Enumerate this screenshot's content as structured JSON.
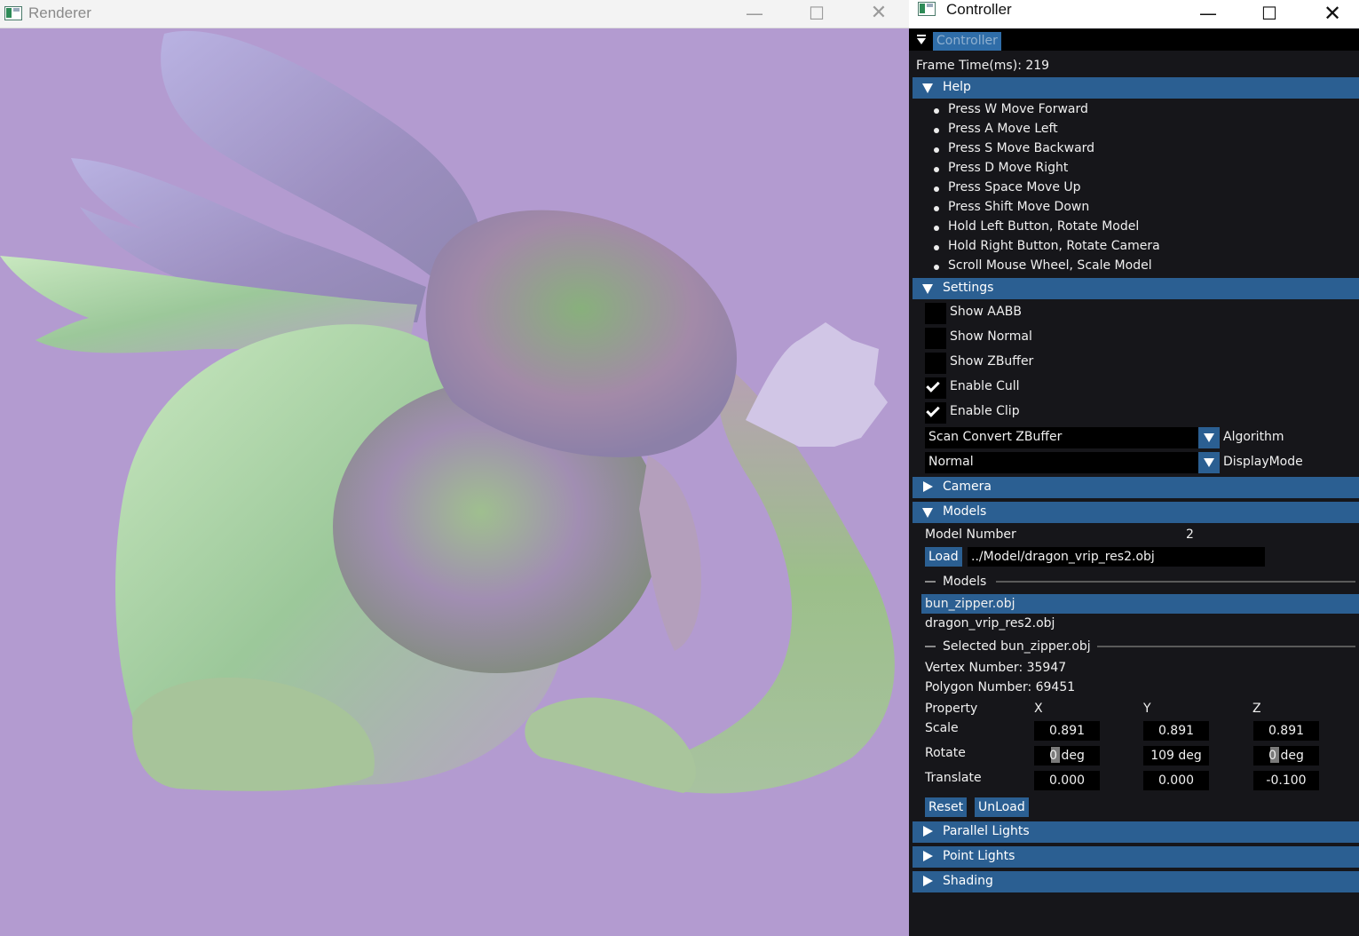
{
  "renderer": {
    "title": "Renderer",
    "min_icon": "minimize-icon",
    "max_icon": "maximize-icon",
    "close_icon": "close-icon",
    "background_color": "#b39bd0"
  },
  "controller": {
    "title": "Controller",
    "panel_title": "Controller",
    "frame_time": "Frame Time(ms): 219",
    "help": {
      "label": "Help",
      "items": [
        "Press W Move Forward",
        "Press A Move Left",
        "Press S Move Backward",
        "Press D Move Right",
        "Press Space Move Up",
        "Press Shift Move Down",
        "Hold Left Button, Rotate Model",
        "Hold Right Button, Rotate Camera",
        "Scroll Mouse Wheel, Scale Model"
      ]
    },
    "settings": {
      "label": "Settings",
      "checkboxes": [
        {
          "label": "Show AABB",
          "checked": false
        },
        {
          "label": "Show Normal",
          "checked": false
        },
        {
          "label": "Show ZBuffer",
          "checked": false
        },
        {
          "label": "Enable Cull",
          "checked": true
        },
        {
          "label": "Enable Clip",
          "checked": true
        }
      ],
      "algorithm_value": "Scan Convert ZBuffer",
      "algorithm_label": "Algorithm",
      "display_value": "Normal",
      "display_label": "DisplayMode"
    },
    "camera": {
      "label": "Camera"
    },
    "models": {
      "label": "Models",
      "model_number_label": "Model Number",
      "model_number_value": "2",
      "load_label": "Load",
      "path_value": "../Model/dragon_vrip_res2.obj",
      "list_header": "Models",
      "list": [
        "bun_zipper.obj",
        "dragon_vrip_res2.obj"
      ],
      "selected_header": "Selected bun_zipper.obj",
      "vertex_number": "Vertex Number: 35947",
      "polygon_number": "Polygon Number: 69451",
      "property_label": "Property",
      "x_label": "X",
      "y_label": "Y",
      "z_label": "Z",
      "scale_label": "Scale",
      "rotate_label": "Rotate",
      "translate_label": "Translate",
      "scale": [
        "0.891",
        "0.891",
        "0.891"
      ],
      "rotate": [
        "0 deg",
        "109 deg",
        "0 deg"
      ],
      "translate": [
        "0.000",
        "0.000",
        "-0.100"
      ],
      "reset_label": "Reset",
      "unload_label": "UnLoad"
    },
    "parallel_lights": {
      "label": "Parallel Lights"
    },
    "point_lights": {
      "label": "Point Lights"
    },
    "shading": {
      "label": "Shading"
    },
    "accent_color": "#2b5f92"
  }
}
